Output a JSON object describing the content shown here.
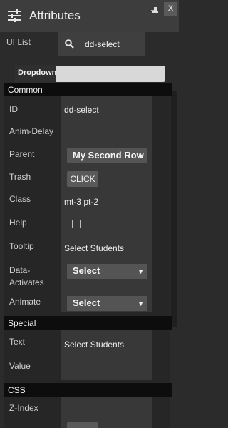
{
  "window": {
    "title": "Attributes",
    "close_label": "X",
    "icons": [
      "sliders-icon",
      "pin-icon"
    ]
  },
  "search": {
    "label": "UI List",
    "value": "dd-select"
  },
  "widget": {
    "tab_label": "Dropdown"
  },
  "sections": {
    "common": "Common",
    "special": "Special",
    "css": "CSS"
  },
  "fields": {
    "id": {
      "label": "ID",
      "value": "dd-select"
    },
    "anim_delay": {
      "label": "Anim-Delay"
    },
    "parent": {
      "label": "Parent",
      "value": "My Second Row"
    },
    "trash": {
      "label": "Trash",
      "button": "CLICK"
    },
    "class": {
      "label": "Class",
      "value": "mt-3 pt-2"
    },
    "help": {
      "label": "Help",
      "checked": false
    },
    "tooltip": {
      "label": "Tooltip",
      "value": "Select Students"
    },
    "data_activates": {
      "label_line1": "Data-",
      "label_line2": "Activates",
      "value": "Select"
    },
    "animate": {
      "label": "Animate",
      "value": "Select"
    },
    "text": {
      "label": "Text",
      "value": "Select Students"
    },
    "value": {
      "label": "Value"
    },
    "z_index": {
      "label": "Z-Index"
    }
  },
  "colors": {
    "titlebar": "#3d3d3d",
    "panel": "#262626",
    "value_cell": "#383838",
    "section_header": "#0d0d0d",
    "select": "#545454"
  }
}
